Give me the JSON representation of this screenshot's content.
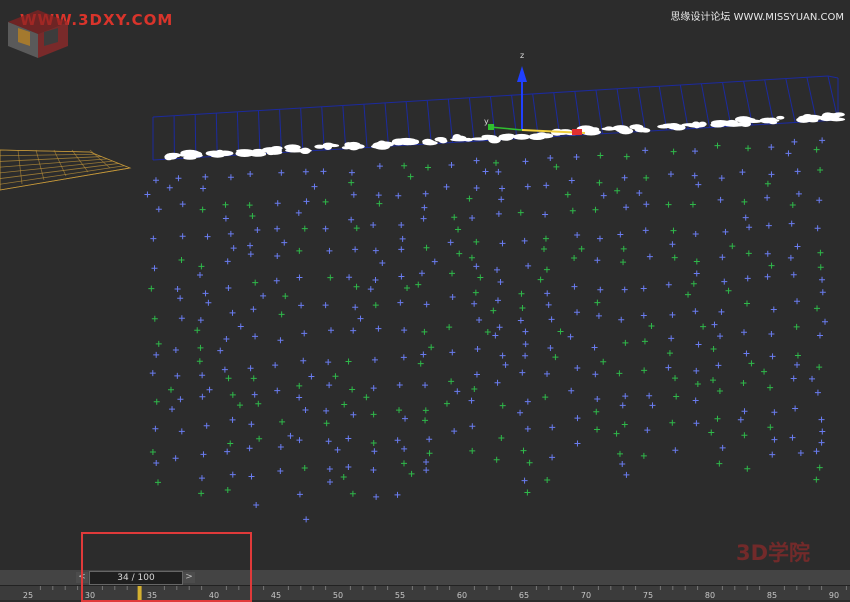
{
  "watermark": {
    "left": "WWW.3DXY.COM",
    "right": "思缘设计论坛 WWW.MISSYUAN.COM"
  },
  "logo": {
    "text": "3D学院"
  },
  "viewport": {
    "gizmo_label_y": "y",
    "gizmo_label_z": "z",
    "colors": {
      "grid_box": "#1c2a9e",
      "particle_blue": "#6a7cf0",
      "particle_green": "#2fb84a",
      "ground_grid": "#c89a3a",
      "gizmo_x": "#e03030",
      "gizmo_y": "#30c030",
      "gizmo_z": "#2040ff"
    }
  },
  "timeline": {
    "frame_display": "34 / 100",
    "prev_arrow": "<",
    "next_arrow": ">",
    "current_frame": 34,
    "total_frames": 100,
    "ruler_labels": [
      "25",
      "30",
      "35",
      "40",
      "45",
      "50",
      "55",
      "60",
      "65",
      "70",
      "75",
      "80",
      "85",
      "90"
    ]
  },
  "highlight": {
    "color": "#e03a3a"
  }
}
